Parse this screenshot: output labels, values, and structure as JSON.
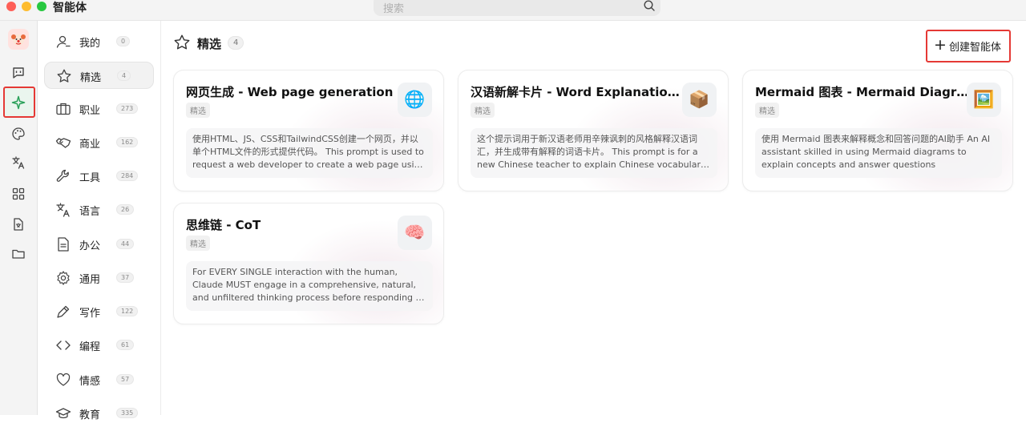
{
  "app": {
    "title": "智能体"
  },
  "search": {
    "placeholder": "搜索"
  },
  "rail": {
    "items": [
      {
        "icon": "message-square-icon"
      },
      {
        "icon": "sparkle-icon",
        "active": true
      },
      {
        "icon": "palette-icon"
      },
      {
        "icon": "translate-icon"
      },
      {
        "icon": "grid-icon"
      },
      {
        "icon": "file-translate-icon"
      },
      {
        "icon": "folder-icon"
      }
    ]
  },
  "categories": [
    {
      "label": "我的",
      "count": "0",
      "icon": "user-icon"
    },
    {
      "label": "精选",
      "count": "4",
      "icon": "star-icon",
      "active": true
    },
    {
      "label": "职业",
      "count": "273",
      "icon": "briefcase-icon"
    },
    {
      "label": "商业",
      "count": "162",
      "icon": "handshake-icon"
    },
    {
      "label": "工具",
      "count": "284",
      "icon": "wrench-icon"
    },
    {
      "label": "语言",
      "count": "26",
      "icon": "translate-icon"
    },
    {
      "label": "办公",
      "count": "44",
      "icon": "document-icon"
    },
    {
      "label": "通用",
      "count": "37",
      "icon": "settings-icon"
    },
    {
      "label": "写作",
      "count": "122",
      "icon": "pen-icon"
    },
    {
      "label": "编程",
      "count": "61",
      "icon": "code-icon"
    },
    {
      "label": "情感",
      "count": "57",
      "icon": "heart-icon"
    },
    {
      "label": "教育",
      "count": "335",
      "icon": "graduation-icon"
    }
  ],
  "main": {
    "title": "精选",
    "count": "4",
    "create_label": "创建智能体",
    "create_icon": "plus-icon",
    "tag_label": "精选"
  },
  "cards": [
    {
      "title": "网页生成 - Web page generation",
      "tag": "精选",
      "emoji": "🌐",
      "desc": "使用HTML、JS、CSS和TailwindCSS创建一个网页，并以单个HTML文件的形式提供代码。 This prompt is used to request a web developer to create a web page using HTML, JS, CSS and TailwindCSS."
    },
    {
      "title": "汉语新解卡片 - Word Explanation Card",
      "tag": "精选",
      "emoji": "📦",
      "desc": "这个提示词用于新汉语老师用辛辣讽刺的风格解释汉语词汇，并生成带有解释的词语卡片。 This prompt is for a new Chinese teacher to explain Chinese vocabulary in a sharp, satirical style."
    },
    {
      "title": "Mermaid 图表 - Mermaid Diagram",
      "tag": "精选",
      "emoji": "🖼️",
      "desc": "使用 Mermaid 图表来解释概念和回答问题的AI助手 An AI assistant skilled in using Mermaid diagrams to explain concepts and answer questions"
    },
    {
      "title": "思维链 - CoT",
      "tag": "精选",
      "emoji": "🧠",
      "desc": "For EVERY SINGLE interaction with the human, Claude MUST engage in a comprehensive, natural, and unfiltered thinking process before responding or tool use."
    }
  ],
  "colors": {
    "accent_green": "#2aa15a",
    "highlight_red": "#e53935"
  }
}
